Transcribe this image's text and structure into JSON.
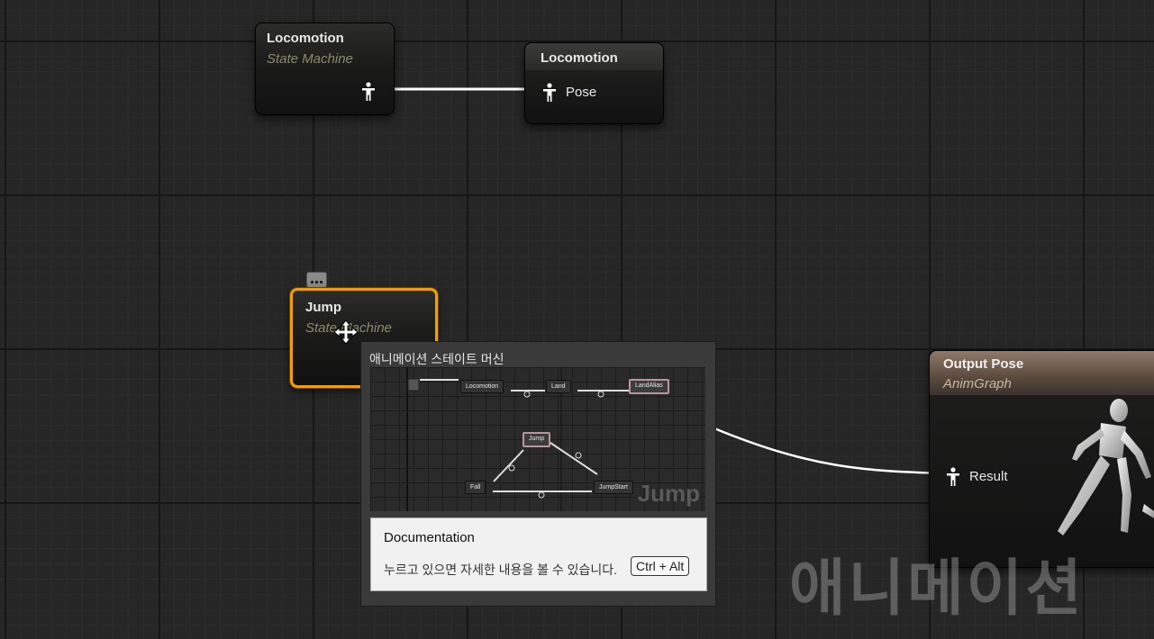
{
  "graph": {
    "nodes": {
      "locomotion_state_machine": {
        "title": "Locomotion",
        "subtitle": "State Machine",
        "output_pin_icon": "person-pose-icon"
      },
      "locomotion_pose": {
        "title": "Locomotion",
        "pin_label": "Pose",
        "pin_icon": "person-pose-icon"
      },
      "jump_state_machine": {
        "title": "Jump",
        "subtitle": "State Machine",
        "selected": true,
        "badge_icon": "ellipsis-icon"
      },
      "output_pose": {
        "title": "Output Pose",
        "subtitle": "AnimGraph",
        "pin_label": "Result",
        "pin_icon": "person-pose-icon"
      }
    },
    "colors": {
      "selection": "#f0a000",
      "output_header": "#8f7a6a",
      "wire": "#ffffff"
    }
  },
  "tooltip": {
    "title": "애니메이션 스테이트 머신",
    "preview": {
      "nodes": [
        "Locomotion",
        "Land",
        "LandAlias",
        "Jump",
        "Fall",
        "JumpStart"
      ],
      "watermark": "Jump"
    },
    "documentation": {
      "title": "Documentation",
      "hint": "누르고 있으면 자세한 내용을 볼 수 있습니다.",
      "shortcut": "Ctrl + Alt"
    }
  },
  "watermark": "애니메이션",
  "cursor": "move-cursor-icon"
}
